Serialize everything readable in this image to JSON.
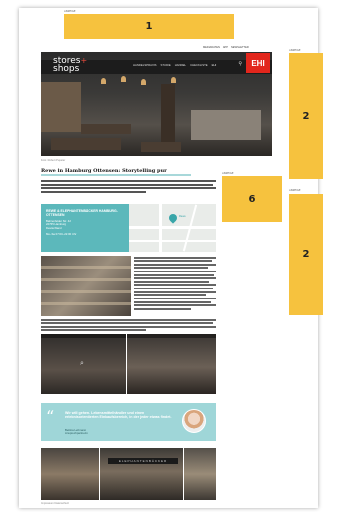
{
  "ads": {
    "top": {
      "label": "ANZEIGE",
      "number": "1"
    },
    "right_top": {
      "label": "ANZEIGE",
      "number": "2"
    },
    "middle": {
      "label": "ANZEIGE",
      "number": "6"
    },
    "right_bottom": {
      "label": "ANZEIGE",
      "number": "2"
    }
  },
  "toplinks": [
    "MEDIADATEN",
    "APP",
    "NEWSLETTER"
  ],
  "header": {
    "brand_line1": "stores",
    "brand_plus": "+",
    "brand_line2": "shops",
    "nav": [
      "HANDELSPRAXIS",
      "STUDIE",
      "HANDEL",
      "CHECKLISTE",
      "EHI"
    ],
    "search_icon": "search-icon",
    "logo": "EHI"
  },
  "article": {
    "image_caption": "Foto: Robert Pupeter",
    "title": "Rewe in Hamburg Ottensen: Storytelling pur"
  },
  "info_card": {
    "heading": "REWE & ELEPHANTENBÄCKER HAMBURG-OTTENSEN",
    "address_line1": "Bahrenfelder Str. 42",
    "address_line2": "22765 Hamburg",
    "address_line3": "Deutschland",
    "hours": "Mo–Sa 07:00–22:00 Uhr"
  },
  "map": {
    "pin_label": "Rewe"
  },
  "quote": {
    "text": "Wir will gehen. Lebensmittelhändler und einen erlebnisorientierten Einkaufsbereich, in der jeder etwas findet.",
    "name": "Bettina Lehmann",
    "role": "Ansprechpartnerin"
  },
  "bottom": {
    "sign_text": "ELEPHANTENBÄCKER",
    "caption": "Impressum  Datenschutz"
  },
  "colors": {
    "ad_yellow": "#f6c23e",
    "teal": "#5cb8bb",
    "light_teal": "#9fd6d8",
    "ehi_red": "#e2261c"
  }
}
